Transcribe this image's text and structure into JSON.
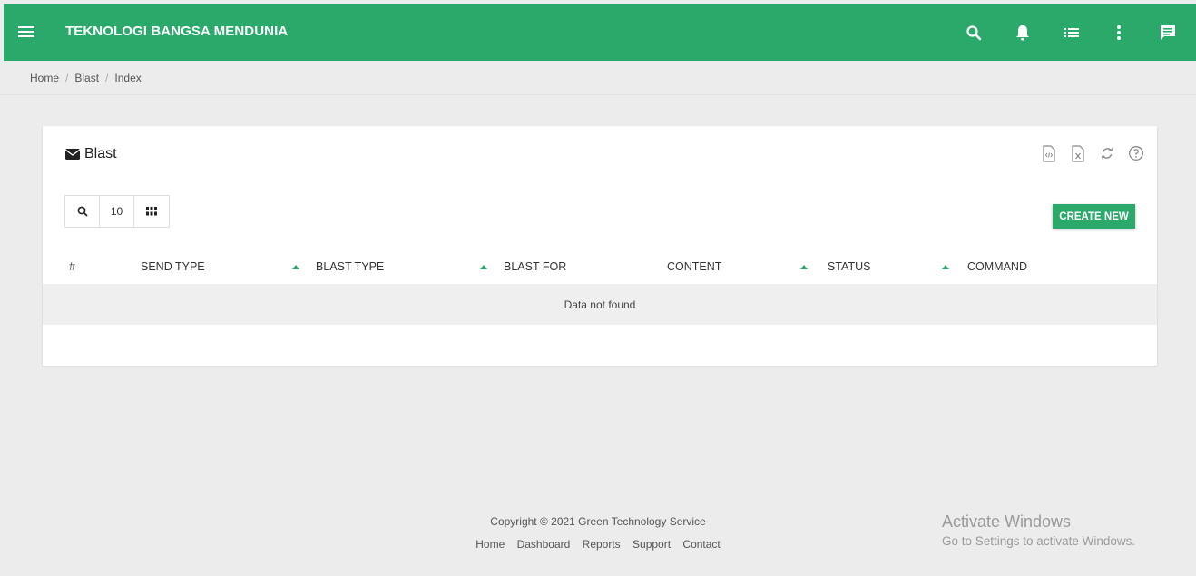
{
  "topbar": {
    "title": "TEKNOLOGI BANGSA MENDUNIA",
    "icons": [
      "menu-icon",
      "search-icon",
      "bell-icon",
      "list-icon",
      "more-vert-icon",
      "chat-icon"
    ],
    "color": "#2ba96b"
  },
  "breadcrumb": {
    "items": [
      "Home",
      "Blast",
      "Index"
    ]
  },
  "card": {
    "title": "Blast",
    "tools": [
      "code-file-icon",
      "excel-file-icon",
      "refresh-icon",
      "help-icon"
    ],
    "toolbar": {
      "page_size": "10"
    },
    "create_label": "CREATE NEW",
    "columns": [
      "#",
      "SEND TYPE",
      "BLAST TYPE",
      "BLAST FOR",
      "CONTENT",
      "STATUS",
      "COMMAND"
    ],
    "empty_text": "Data not found"
  },
  "footer": {
    "copyright": "Copyright © 2021 Green Technology Service",
    "links": [
      "Home",
      "Dashboard",
      "Reports",
      "Support",
      "Contact"
    ]
  },
  "watermark": {
    "line1": "Activate Windows",
    "line2": "Go to Settings to activate Windows."
  }
}
